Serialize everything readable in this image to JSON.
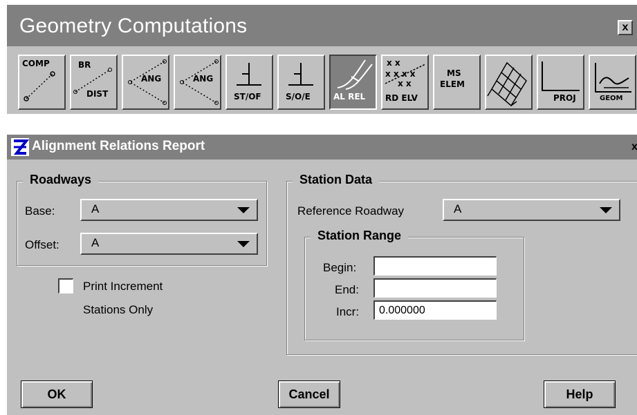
{
  "palette": {
    "title": "Geometry Computations",
    "close": "x",
    "tools": [
      {
        "name": "tool-comp",
        "icon": "comp-icon",
        "line1": "COMP",
        "line2": ""
      },
      {
        "name": "tool-br-dist",
        "icon": "bearing-distance-icon",
        "line1": "BR",
        "line2": "DIST"
      },
      {
        "name": "tool-ang-1",
        "icon": "angle-icon",
        "line1": "ANG",
        "line2": ""
      },
      {
        "name": "tool-ang-2",
        "icon": "angle-icon",
        "line1": "ANG",
        "line2": ""
      },
      {
        "name": "tool-st-of",
        "icon": "station-offset-icon",
        "line1": "ST/OF",
        "line2": ""
      },
      {
        "name": "tool-s-o-e",
        "icon": "station-offset-elevation-icon",
        "line1": "S/O/E",
        "line2": ""
      },
      {
        "name": "tool-al-rel",
        "icon": "alignment-relations-icon",
        "line1": "AL REL",
        "line2": ""
      },
      {
        "name": "tool-rd-elv",
        "icon": "roadway-elevation-icon",
        "line1": "RD ELV",
        "line2": ""
      },
      {
        "name": "tool-ms-elem",
        "icon": "ms-element-icon",
        "line1": "MS",
        "line2": "ELEM"
      },
      {
        "name": "tool-grid",
        "icon": "grid-icon",
        "line1": "",
        "line2": ""
      },
      {
        "name": "tool-proj",
        "icon": "projection-icon",
        "line1": "PROJ",
        "line2": ""
      },
      {
        "name": "tool-geom",
        "icon": "geometry-graph-icon",
        "line1": "GEOM",
        "line2": ""
      }
    ],
    "active_tool": "tool-al-rel"
  },
  "dialog": {
    "title": "Alignment Relations Report",
    "close": "x",
    "roadways": {
      "title": "Roadways",
      "base_label": "Base:",
      "base_value": "A",
      "offset_label": "Offset:",
      "offset_value": "A"
    },
    "print_increment": {
      "label_line1": "Print Increment",
      "label_line2": "Stations Only",
      "checked": false
    },
    "station_data": {
      "title": "Station Data",
      "reference_label": "Reference Roadway",
      "reference_value": "A",
      "range": {
        "title": "Station Range",
        "begin_label": "Begin:",
        "begin_value": "",
        "end_label": "End:",
        "end_value": "",
        "incr_label": "Incr:",
        "incr_value": "0.000000"
      }
    },
    "buttons": {
      "ok": "OK",
      "cancel": "Cancel",
      "help": "Help"
    }
  }
}
